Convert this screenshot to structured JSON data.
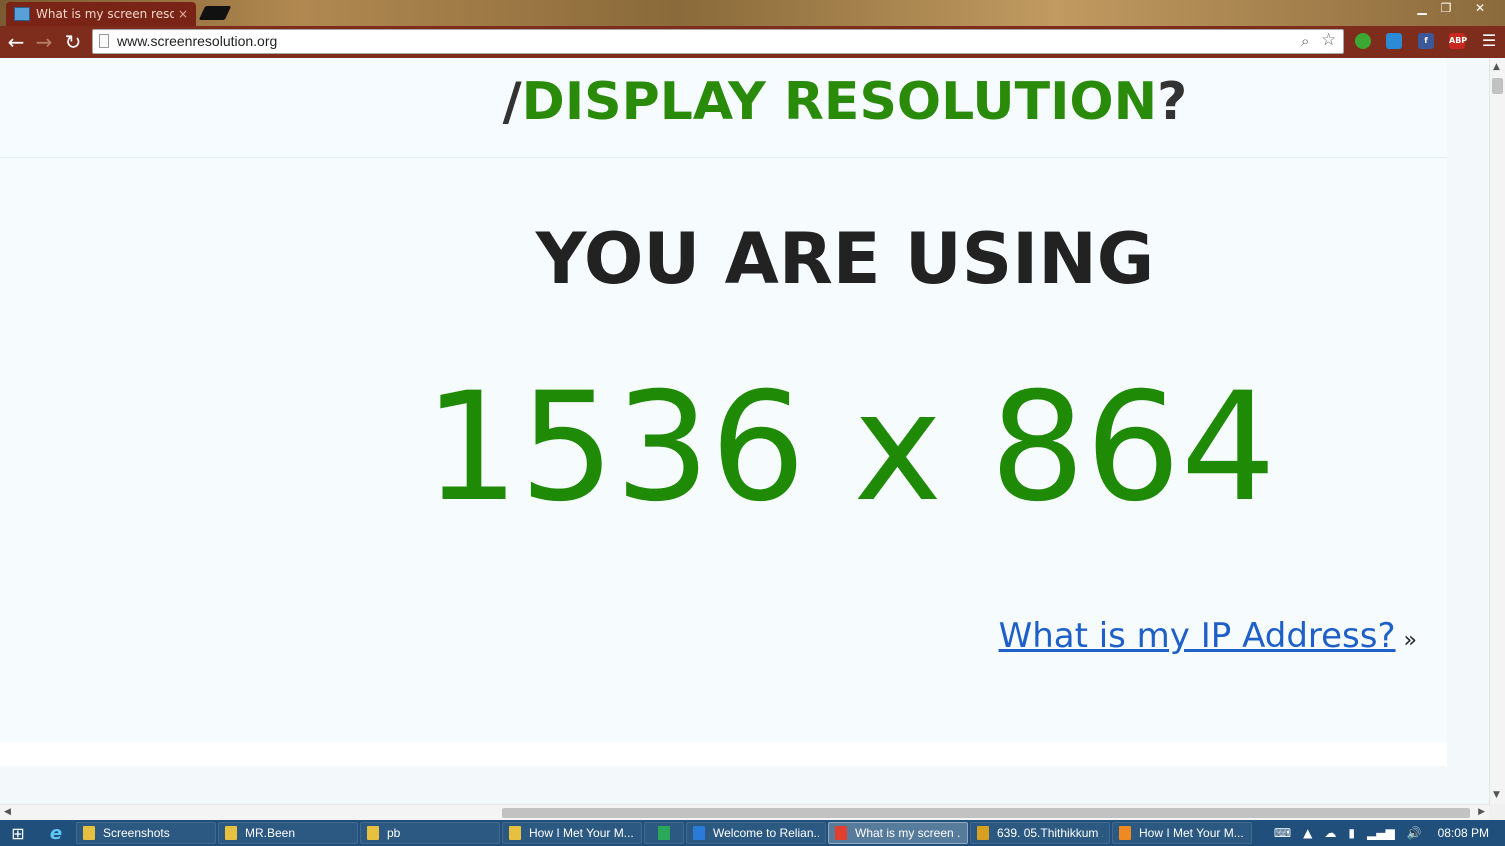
{
  "browser": {
    "tab_title": "What is my screen resoluti",
    "tab_close": "×",
    "url": "www.screenresolution.org",
    "nav": {
      "back": "←",
      "forward": "→",
      "reload": "↻"
    },
    "window_controls": {
      "minimize": "▁",
      "restore": "❐",
      "close": "✕"
    },
    "extensions": [
      {
        "name": "green-shield-ext",
        "label": "",
        "color": "#3aa832"
      },
      {
        "name": "cast-ext",
        "label": "",
        "color": "#2d8bd6"
      },
      {
        "name": "facebook-ext",
        "label": "f",
        "color": "#3b5998"
      },
      {
        "name": "adblock-ext",
        "label": "ABP",
        "color": "#c8281e"
      }
    ]
  },
  "page": {
    "heading_slash": "/",
    "heading_main": "DISPLAY RESOLUTION",
    "heading_q": "?",
    "you_are_using": "YOU ARE USING",
    "resolution": "1536 x 864",
    "ip_link": "What is my IP Address?",
    "ip_arrow": "»"
  },
  "taskbar": {
    "items": [
      {
        "label": "Screenshots",
        "color": "#e8c040",
        "active": false
      },
      {
        "label": "MR.Been",
        "color": "#e8c040",
        "active": false
      },
      {
        "label": "pb",
        "color": "#e8c040",
        "active": false
      },
      {
        "label": "How I Met Your M...",
        "color": "#e8c040",
        "active": false
      },
      {
        "label": "",
        "color": "#2aa85a",
        "active": false
      },
      {
        "label": "Welcome to Relian...",
        "color": "#2a7ad8",
        "active": false
      },
      {
        "label": "What is my screen ...",
        "color": "#e04030",
        "active": true
      },
      {
        "label": "639. 05.Thithikkum ...",
        "color": "#d8a020",
        "active": false
      },
      {
        "label": "How I Met Your M...",
        "color": "#f08a20",
        "active": false
      }
    ],
    "clock": "08:08 PM"
  }
}
